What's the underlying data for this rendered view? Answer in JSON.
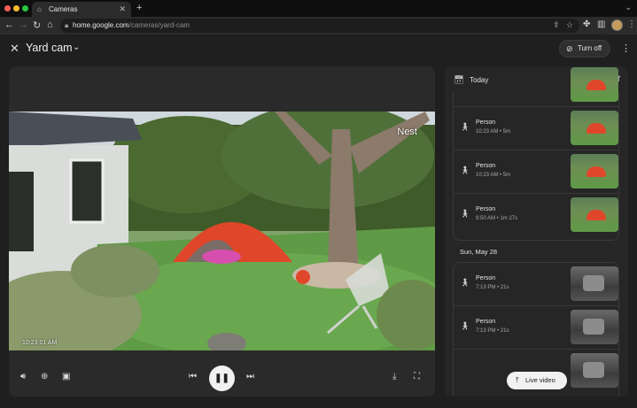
{
  "browser": {
    "tab_title": "Cameras",
    "new_tab": "+",
    "url_host": "home.google.com",
    "url_path": "/cameras/yard-cam",
    "traffic_lights": {
      "close": "#ff5f57",
      "minimize": "#febc2e",
      "maximize": "#28c840"
    }
  },
  "header": {
    "camera_name": "Yard cam",
    "turn_off_label": "Turn off"
  },
  "video": {
    "watermark": "Nest",
    "timestamp": "10:23:01 AM"
  },
  "panel": {
    "today_label": "Today",
    "second_day_label": "Sun, May 28",
    "today_events": [
      {
        "label": "Person",
        "meta": "10:23 AM • 5m"
      },
      {
        "label": "Person",
        "meta": "10:23 AM • 5m"
      },
      {
        "label": "Person",
        "meta": "9:50 AM • 1m 27s"
      }
    ],
    "may28_events": [
      {
        "label": "Person",
        "meta": "7:13 PM • 21s"
      },
      {
        "label": "Person",
        "meta": "7:13 PM • 21s"
      }
    ],
    "live_video_label": "Live video"
  },
  "colors": {
    "accent_tent": "#e0472a",
    "panel_bg": "#262626",
    "page_bg": "#1f1f1f"
  }
}
